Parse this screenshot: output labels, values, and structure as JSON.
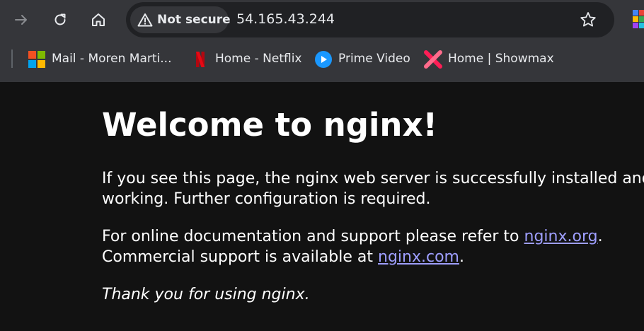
{
  "browser": {
    "security_label": "Not secure",
    "url": "54.165.43.244",
    "bookmarks": [
      {
        "label": "Mail - Moren Marti...",
        "icon": "microsoft-icon"
      },
      {
        "label": "Home - Netflix",
        "icon": "netflix-icon"
      },
      {
        "label": "Prime Video",
        "icon": "prime-video-icon"
      },
      {
        "label": "Home | Showmax",
        "icon": "showmax-icon"
      }
    ],
    "colors": {
      "toolbar": "#35363a",
      "omnibox": "#202124",
      "text": "#e8eaed"
    }
  },
  "page": {
    "title": "Welcome to nginx!",
    "para1_line1": "If you see this page, the nginx web server is successfully installed and",
    "para1_line2": "working. Further configuration is required.",
    "para2_line1_prefix": "For online documentation and support please refer to ",
    "para2_link1": "nginx.org",
    "para2_line1_suffix": ".",
    "para2_line2_prefix": "Commercial support is available at ",
    "para2_link2": "nginx.com",
    "para2_line2_suffix": ".",
    "para3": "Thank you for using nginx.",
    "colors": {
      "background": "#121212",
      "text": "#ffffff",
      "link": "#9e9eff"
    }
  }
}
